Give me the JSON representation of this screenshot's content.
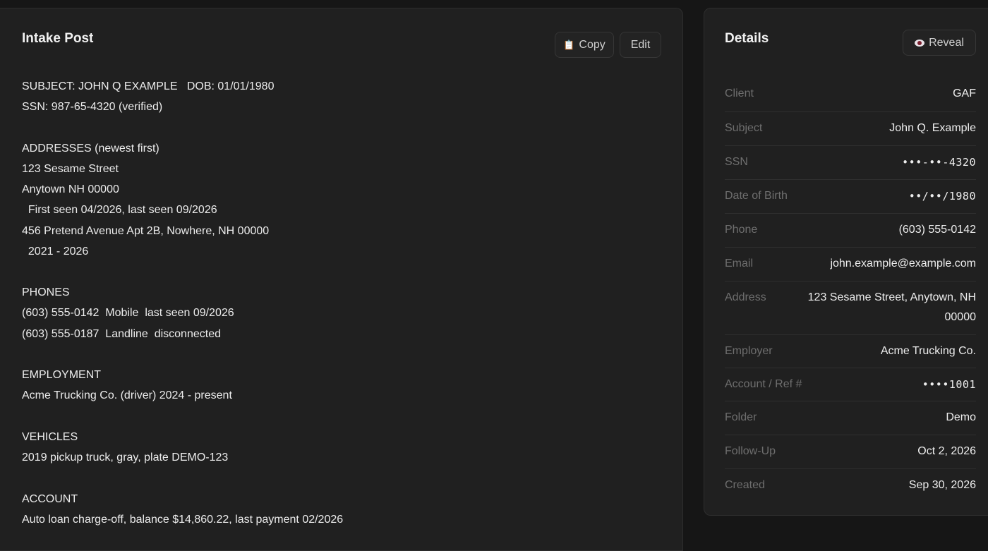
{
  "intake": {
    "title": "Intake Post",
    "copy_label": "Copy",
    "edit_label": "Edit",
    "lines": [
      "SUBJECT: JOHN Q EXAMPLE   DOB: 01/01/1980",
      "SSN: 987-65-4320 (verified)",
      "",
      "ADDRESSES (newest first)",
      "123 Sesame Street",
      "Anytown NH 00000",
      "  First seen 04/2026, last seen 09/2026",
      "456 Pretend Avenue Apt 2B, Nowhere, NH 00000",
      "  2021 - 2026",
      "",
      "PHONES",
      "(603) 555-0142  Mobile  last seen 09/2026",
      "(603) 555-0187  Landline  disconnected",
      "",
      "EMPLOYMENT",
      "Acme Trucking Co. (driver) 2024 - present",
      "",
      "VEHICLES",
      "2019 pickup truck, gray, plate DEMO-123",
      "",
      "ACCOUNT",
      "Auto loan charge-off, balance $14,860.22, last payment 02/2026"
    ]
  },
  "details": {
    "title": "Details",
    "reveal_label": "Reveal",
    "rows": [
      {
        "label": "Client",
        "value": "GAF"
      },
      {
        "label": "Subject",
        "value": "John Q. Example"
      },
      {
        "label": "SSN",
        "value": "•••-••-4320"
      },
      {
        "label": "Date of Birth",
        "value": "••/••/1980"
      },
      {
        "label": "Phone",
        "value": "(603) 555-0142"
      },
      {
        "label": "Email",
        "value": "john.example@example.com"
      },
      {
        "label": "Address",
        "value": "123 Sesame Street, Anytown, NH 00000"
      },
      {
        "label": "Employer",
        "value": "Acme Trucking Co."
      },
      {
        "label": "Account / Ref #",
        "value": "••••1001"
      },
      {
        "label": "Folder",
        "value": "Demo"
      },
      {
        "label": "Follow-Up",
        "value": "Oct 2, 2026"
      },
      {
        "label": "Created",
        "value": "Sep 30, 2026"
      }
    ]
  }
}
